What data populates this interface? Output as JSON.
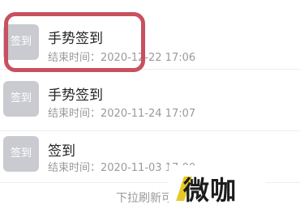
{
  "records": [
    {
      "icon_label": "签到",
      "title": "手势签到",
      "end_time": "结束时间：2020-12-22 17:06"
    },
    {
      "icon_label": "签到",
      "title": "手势签到",
      "end_time": "结束时间：2020-11-24 17:07"
    },
    {
      "icon_label": "签到",
      "title": "签到",
      "end_time": "结束时间：2020-11-03 17:00"
    }
  ],
  "footer": {
    "pull_refresh": "下拉刷新可查"
  },
  "watermark": {
    "text": "微咖"
  },
  "colors": {
    "highlight": "#c8505f",
    "icon_bg": "#c9cbd0",
    "watermark_accent": "#e8c826"
  }
}
